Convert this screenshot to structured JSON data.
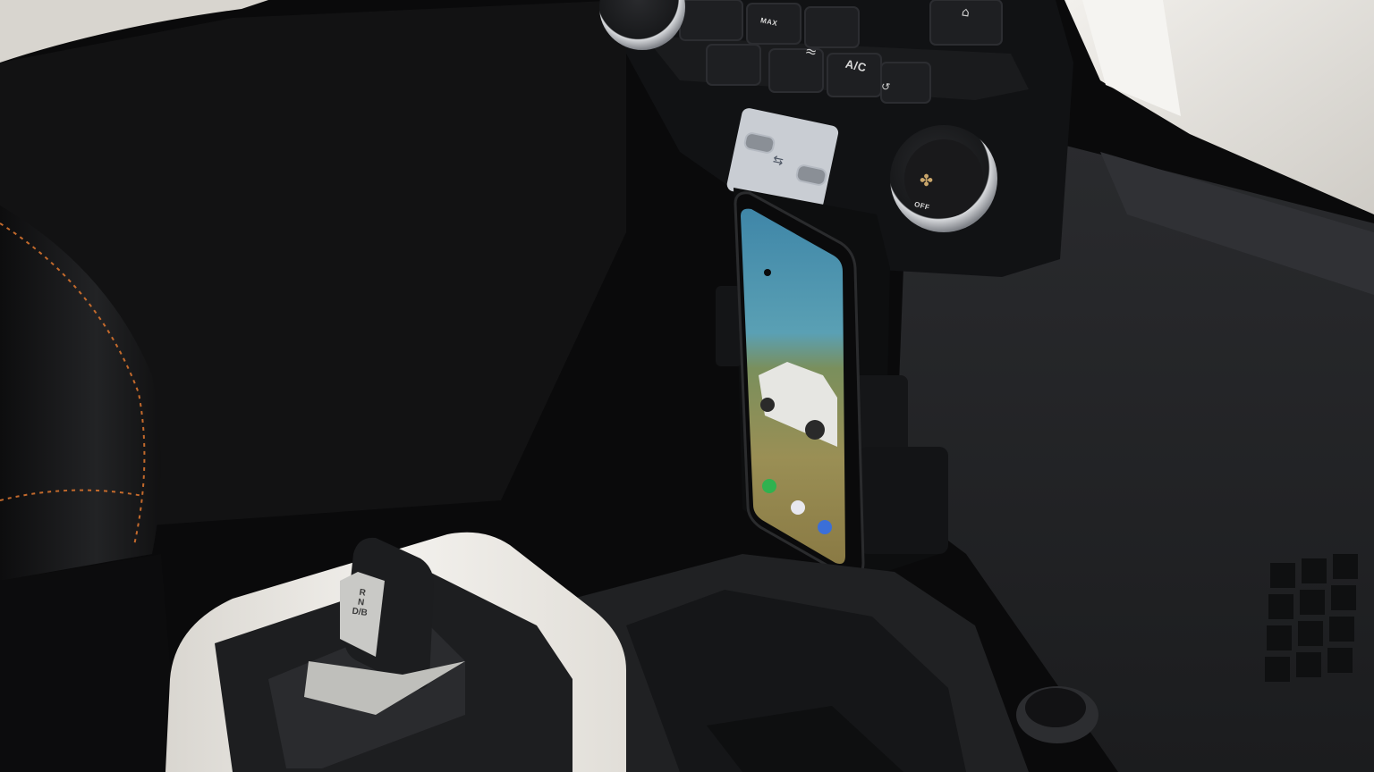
{
  "controls": {
    "ac_label": "A/C",
    "max_label": "MAX",
    "off_label": "OFF"
  },
  "shifter": {
    "gear_r": "R",
    "gear_n": "N",
    "gear_d": "D/B"
  },
  "icons": {
    "usb": "usb-icon",
    "fan": "fan-icon",
    "recirculation": "recirculation-icon",
    "airflow": "airflow-icon",
    "defrost": "defrost-icon"
  },
  "colors": {
    "dashboard_white": "#e9e7e2",
    "console_black": "#111214",
    "trim_gray": "#2a2b2e",
    "knob_silver": "#b9bcc1",
    "seat_stitch": "#c46a2c"
  }
}
